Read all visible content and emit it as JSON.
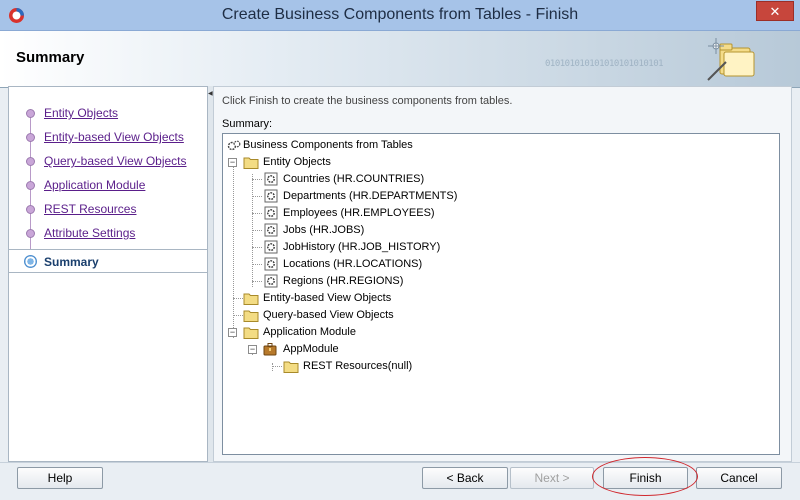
{
  "window": {
    "title": "Create Business Components from Tables - Finish",
    "close_glyph": "✕"
  },
  "header": {
    "title": "Summary",
    "binary_text": "010101010101010101010101"
  },
  "nav": {
    "items": [
      {
        "label": "Entity Objects"
      },
      {
        "label": "Entity-based View Objects"
      },
      {
        "label": "Query-based View Objects"
      },
      {
        "label": "Application Module"
      },
      {
        "label": "REST Resources"
      },
      {
        "label": "Attribute Settings"
      }
    ],
    "current": "Summary"
  },
  "content": {
    "instruction": "Click Finish to create the business components from tables.",
    "summary_label": "Summary:"
  },
  "tree": {
    "root": "Business Components from Tables",
    "entity_folder": "Entity Objects",
    "entities": [
      "Countries (HR.COUNTRIES)",
      "Departments (HR.DEPARTMENTS)",
      "Employees (HR.EMPLOYEES)",
      "Jobs (HR.JOBS)",
      "JobHistory (HR.JOB_HISTORY)",
      "Locations (HR.LOCATIONS)",
      "Regions (HR.REGIONS)"
    ],
    "entity_view_folder": "Entity-based View Objects",
    "query_view_folder": "Query-based View Objects",
    "app_module_folder": "Application Module",
    "app_module": "AppModule",
    "rest_resources": "REST Resources(null)",
    "expanded_glyph": "−"
  },
  "buttons": {
    "help": "Help",
    "back": "< Back",
    "next": "Next >",
    "finish": "Finish",
    "cancel": "Cancel"
  },
  "colors": {
    "visited_link": "#5a1e8a",
    "highlight_ring": "#d0282e"
  }
}
